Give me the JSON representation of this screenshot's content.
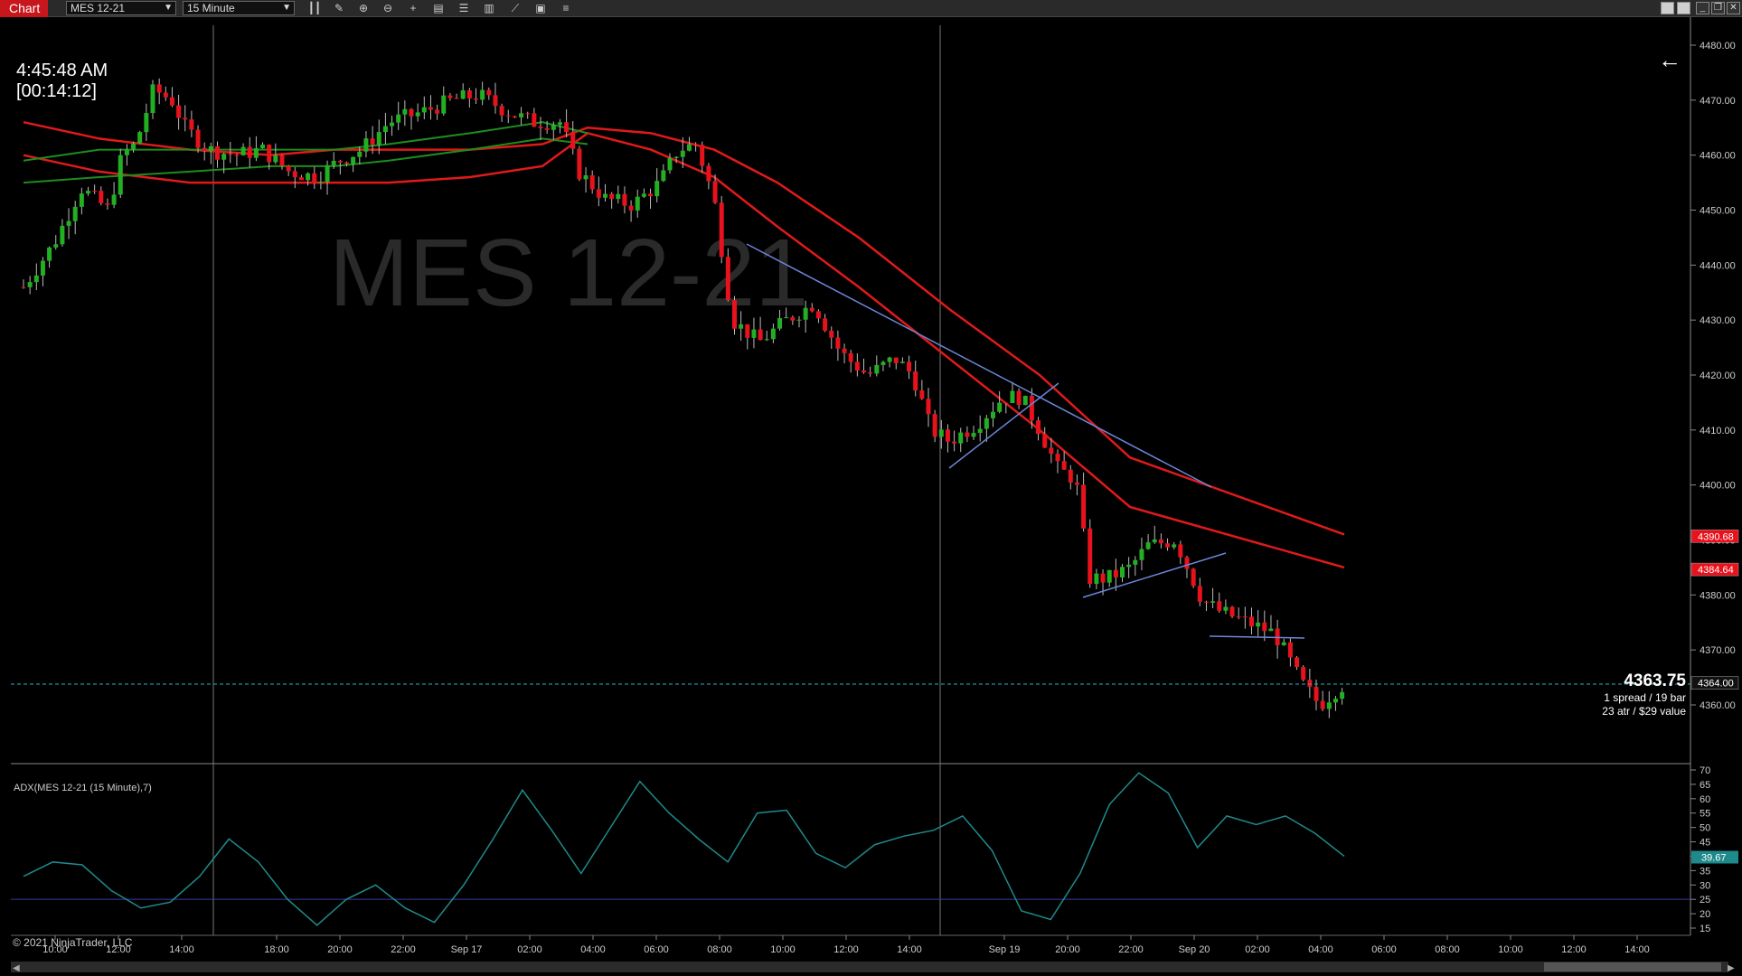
{
  "toolbar": {
    "tab_label": "Chart",
    "instrument": "MES 12-21",
    "interval": "15 Minute",
    "icons": [
      "bar-type-icon",
      "draw-pencil-icon",
      "zoom-in-icon",
      "zoom-out-icon",
      "crosshair-icon",
      "data-box-icon",
      "properties-icon",
      "indicators-icon",
      "strategies-icon",
      "templates-icon",
      "object-list-icon"
    ]
  },
  "watermark": "MES 12-21",
  "clock": {
    "time": "4:45:48 AM",
    "bar_timer": "[00:14:12]"
  },
  "price_info": {
    "last": "4363.75",
    "line1": "1 spread / 19 bar",
    "line2": "23 atr / $29 value"
  },
  "colors": {
    "up": "#22b022",
    "down": "#e8121c",
    "ema_red": "#e01a1a",
    "ema_green": "#1e8c1e",
    "trend": "#6d86d9",
    "adx": "#1f8a8c",
    "cursor_line": "#1fb6c8"
  },
  "price_axis": {
    "ticks": [
      "4480.00",
      "4470.00",
      "4460.00",
      "4450.00",
      "4440.00",
      "4430.00",
      "4420.00",
      "4410.00",
      "4400.00",
      "4390.00",
      "4380.00",
      "4370.00",
      "4360.00"
    ],
    "markers": [
      {
        "label": "4390.68",
        "color": "#e8121c"
      },
      {
        "label": "4384.64",
        "color": "#e8121c"
      },
      {
        "label": "4364.00",
        "color": "#111111"
      }
    ]
  },
  "time_axis": {
    "labels": [
      "10:00",
      "12:00",
      "14:00",
      "18:00",
      "20:00",
      "22:00",
      "Sep 17",
      "02:00",
      "04:00",
      "06:00",
      "08:00",
      "10:00",
      "12:00",
      "14:00",
      "Sep 19",
      "20:00",
      "22:00",
      "Sep 20",
      "02:00",
      "04:00",
      "06:00",
      "08:00",
      "10:00",
      "12:00",
      "14:00"
    ]
  },
  "adx_panel": {
    "label": "ADX(MES 12-21 (15 Minute),7)",
    "ticks": [
      "70",
      "65",
      "60",
      "55",
      "50",
      "45",
      "40",
      "35",
      "30",
      "25",
      "20",
      "15"
    ],
    "current": "39.67",
    "current_color": "#1f8a8c",
    "level": 25
  },
  "copyright": "© 2021 NinjaTrader, LLC",
  "chart_data": {
    "type": "candlestick",
    "instrument": "MES 12-21",
    "interval": "15 Minute",
    "ylim": [
      4355,
      4482
    ],
    "last_price": 4363.75,
    "ema_bands": [
      {
        "color": "red",
        "values": [
          4466,
          4463,
          4461,
          4460,
          4461,
          4461,
          4461,
          4462,
          4465,
          4464,
          4461,
          4455,
          4445,
          4432,
          4420,
          4405,
          4391
        ]
      },
      {
        "color": "red",
        "values": [
          4460,
          4457,
          4455,
          4455,
          4455,
          4455,
          4456,
          4458,
          4464,
          4461,
          4456,
          4447,
          4436,
          4423,
          4410,
          4396,
          4385
        ]
      },
      {
        "color": "green",
        "values": [
          4455,
          4456,
          4457,
          4458,
          4458,
          4459,
          4461,
          4463,
          4462
        ]
      },
      {
        "color": "green",
        "values": [
          4459,
          4461,
          4461,
          4461,
          4461,
          4462,
          4464,
          4466,
          4464
        ]
      }
    ],
    "adx_values": [
      33,
      38,
      37,
      28,
      22,
      24,
      33,
      46,
      38,
      25,
      16,
      25,
      30,
      22,
      17,
      30,
      46,
      63,
      49,
      34,
      50,
      66,
      55,
      46,
      38,
      55,
      56,
      41,
      36,
      44,
      47,
      49,
      54,
      42,
      21,
      18,
      34,
      58,
      69,
      62,
      43,
      54,
      51,
      54,
      48,
      40
    ]
  }
}
